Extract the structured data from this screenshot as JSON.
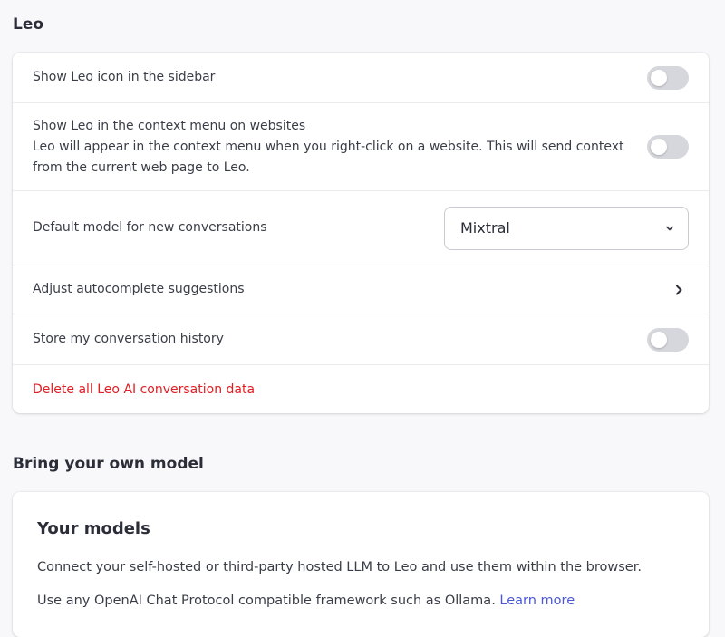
{
  "leo_section": {
    "title": "Leo",
    "show_icon_label": "Show Leo icon in the sidebar",
    "context_menu_label": "Show Leo in the context menu on websites",
    "context_menu_desc_1": "Leo will appear in the context menu when you right-click on a website. This will send context",
    "context_menu_desc_2": "from the current web page to Leo.",
    "default_model_label": "Default model for new conversations",
    "default_model_value": "Mixtral",
    "autocomplete_label": "Adjust autocomplete suggestions",
    "history_label": "Store my conversation history",
    "delete_label": "Delete all Leo AI conversation data"
  },
  "byom_section": {
    "title": "Bring your own model",
    "models_title": "Your models",
    "intro": "Connect your self-hosted or third-party hosted LLM to Leo and use them within the browser.",
    "protocol_text": "Use any OpenAI Chat Protocol compatible framework such as Ollama.",
    "learn_more": "Learn more"
  },
  "toggles": {
    "show_icon": false,
    "context_menu": false,
    "store_history": false
  },
  "colors": {
    "danger": "#e11d23",
    "link": "#4b57d6",
    "toggle_off": "#d6d7dc"
  }
}
